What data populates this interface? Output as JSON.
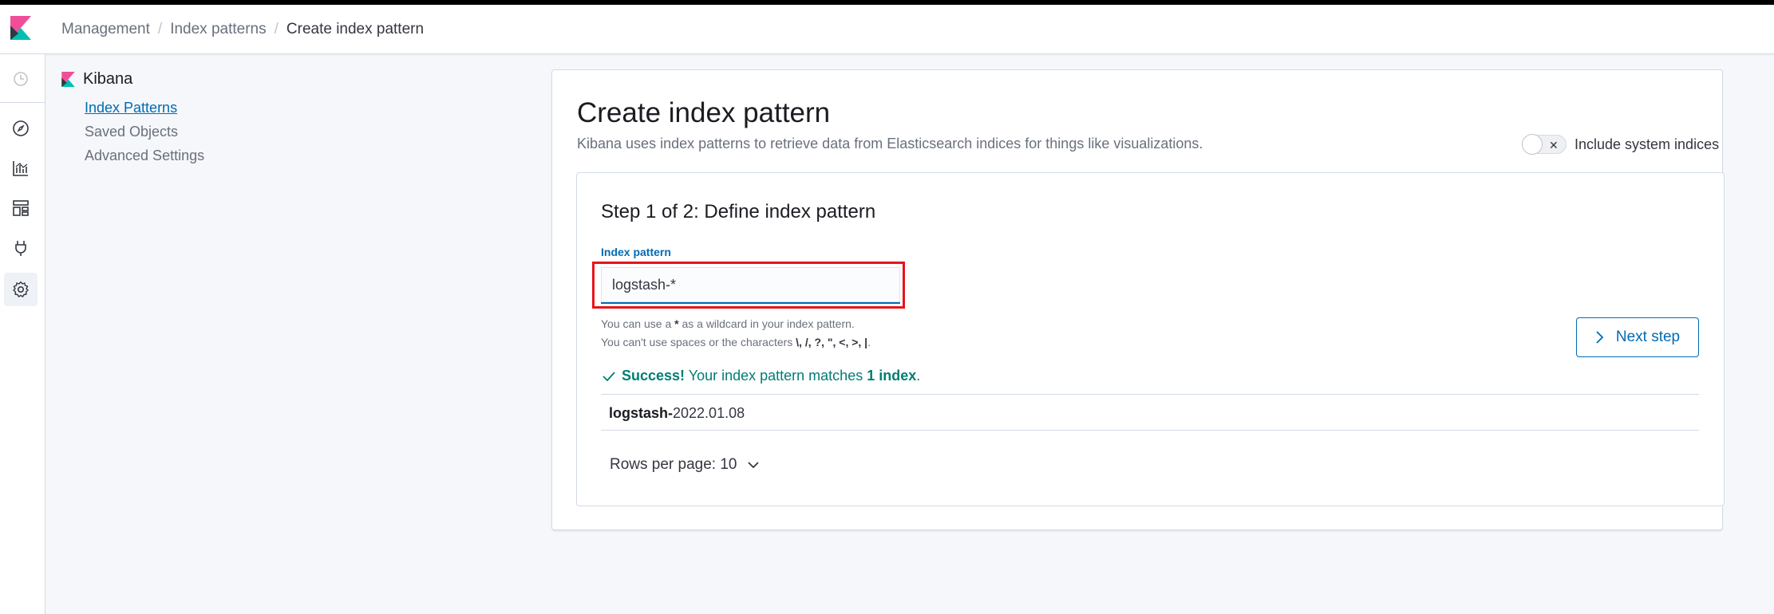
{
  "header": {
    "breadcrumbs": [
      "Management",
      "Index patterns",
      "Create index pattern"
    ],
    "separator": "/"
  },
  "sidenav": {
    "title": "Kibana",
    "items": [
      {
        "label": "Index Patterns",
        "active": true
      },
      {
        "label": "Saved Objects",
        "active": false
      },
      {
        "label": "Advanced Settings",
        "active": false
      }
    ]
  },
  "navbar": {
    "icons": [
      "recent-icon",
      "discover-icon",
      "visualize-icon",
      "dashboard-icon",
      "dev-tools-icon",
      "management-gear-icon"
    ]
  },
  "main": {
    "title": "Create index pattern",
    "description": "Kibana uses index patterns to retrieve data from Elasticsearch indices for things like visualizations.",
    "toggle_label": "Include system indices",
    "toggle_on": false,
    "step_title": "Step 1 of 2: Define index pattern",
    "field_label": "Index pattern",
    "input_value": "logstash-*",
    "help_line1_pre": "You can use a ",
    "help_line1_star": "*",
    "help_line1_post": " as a wildcard in your index pattern.",
    "help_line2_pre": "You can't use spaces or the characters ",
    "help_line2_chars": "\\, /, ?, \", <, >, |",
    "help_line2_post": ".",
    "next_button": "Next step",
    "success_strong": "Success!",
    "success_text": " Your index pattern matches ",
    "success_count": "1 index",
    "success_end": ".",
    "match_prefix": "logstash-",
    "match_suffix": "2022.01.08",
    "rows_per_page": "Rows per page: 10"
  },
  "colors": {
    "primary": "#006bb4",
    "success": "#017d73",
    "highlight": "#e7141a",
    "logo_pink": "#f04e98",
    "logo_teal": "#00bfb3"
  }
}
